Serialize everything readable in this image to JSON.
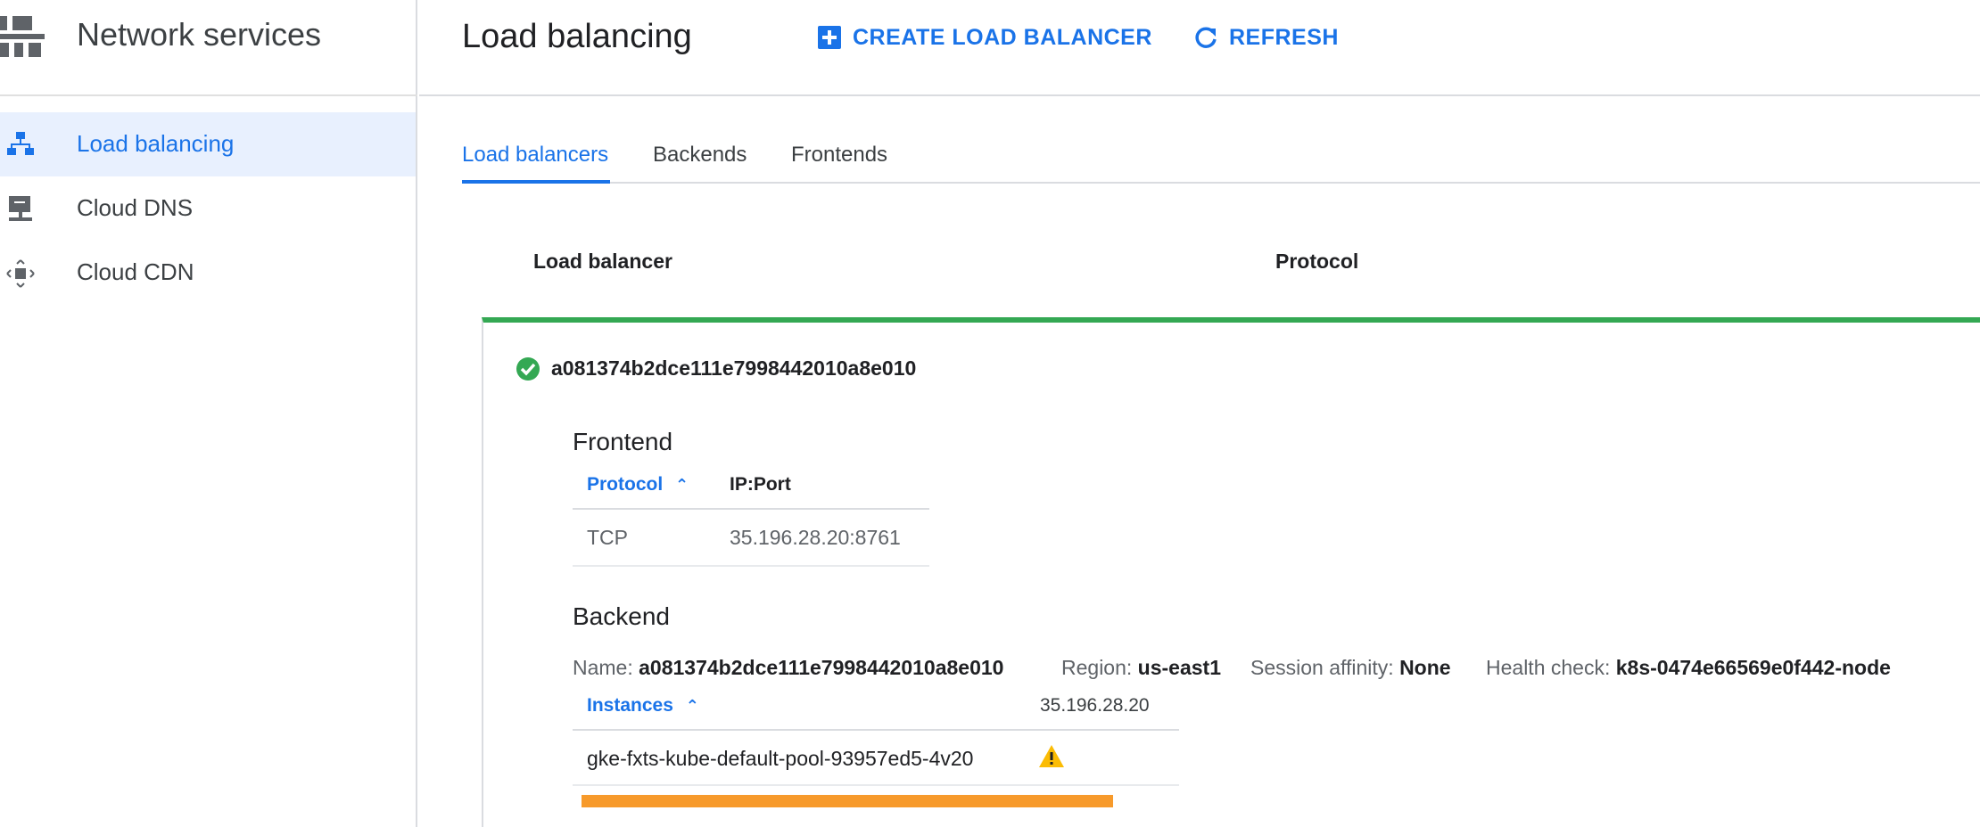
{
  "sidebar": {
    "title": "Network services",
    "items": [
      {
        "label": "Load balancing",
        "icon": "load-balancing-icon",
        "active": true
      },
      {
        "label": "Cloud DNS",
        "icon": "dns-icon",
        "active": false
      },
      {
        "label": "Cloud CDN",
        "icon": "cdn-icon",
        "active": false
      }
    ]
  },
  "header": {
    "title": "Load balancing",
    "create_label": "CREATE LOAD BALANCER",
    "refresh_label": "REFRESH"
  },
  "tabs": [
    {
      "label": "Load balancers",
      "active": true
    },
    {
      "label": "Backends",
      "active": false
    },
    {
      "label": "Frontends",
      "active": false
    }
  ],
  "list": {
    "columns": [
      "Load balancer",
      "Protocol"
    ]
  },
  "load_balancer": {
    "name": "a081374b2dce111e7998442010a8e010",
    "status": "ok",
    "frontend": {
      "title": "Frontend",
      "columns": [
        "Protocol",
        "IP:Port"
      ],
      "rows": [
        [
          "TCP",
          "35.196.28.20:8761"
        ]
      ]
    },
    "backend": {
      "title": "Backend",
      "name_label": "Name:",
      "name": "a081374b2dce111e7998442010a8e010",
      "region_label": "Region:",
      "region": "us-east1",
      "affinity_label": "Session affinity:",
      "affinity": "None",
      "health_label": "Health check:",
      "health": "k8s-0474e66569e0f442-node",
      "instances_header": "Instances",
      "ip_header": "35.196.28.20",
      "instances": [
        "gke-fxts-kube-default-pool-93957ed5-4v20"
      ],
      "instance_status": "warning"
    }
  },
  "colors": {
    "accent": "#1a73e8",
    "healthy": "#34a853",
    "warning": "#fbbc04",
    "health_bar": "#f79a2b"
  }
}
